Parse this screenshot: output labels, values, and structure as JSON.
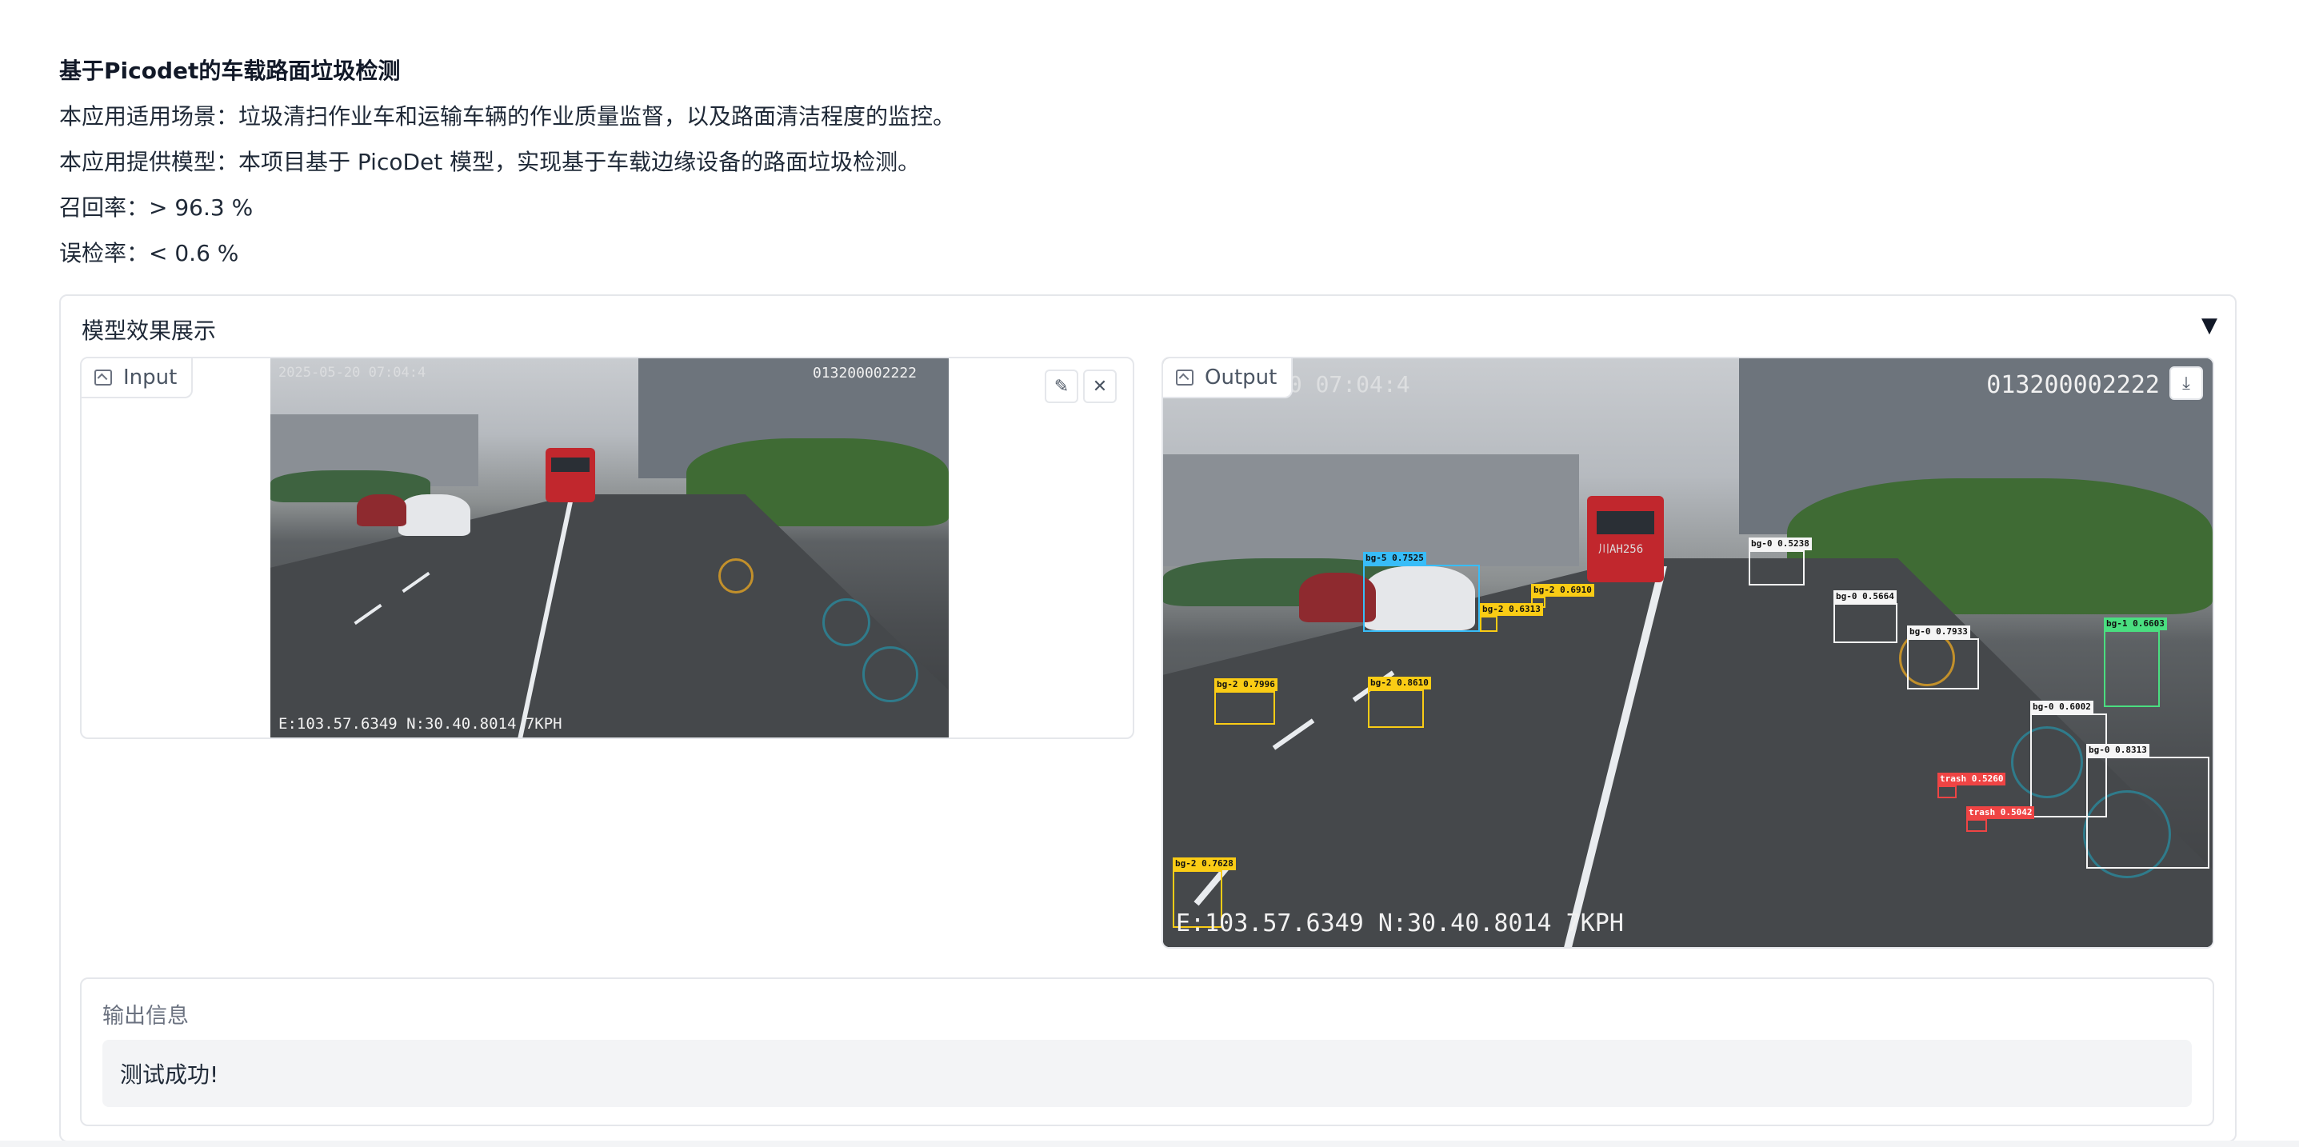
{
  "intro": {
    "title": "基于Picodet的车载路面垃圾检测",
    "scenario": "本应用适用场景：垃圾清扫作业车和运输车辆的作业质量监督，以及路面清洁程度的监控。",
    "model": "本应用提供模型：本项目基于 PicoDet 模型，实现基于车载边缘设备的路面垃圾检测。",
    "recall": "召回率：> 96.3 %",
    "false_detection": "误检率：< 0.6 %"
  },
  "accordion": {
    "title": "模型效果展示",
    "toggle_icon": "▼"
  },
  "input_panel": {
    "label": "Input",
    "edit_icon": "✎",
    "close_icon": "✕",
    "overlay_time": "2025-05-20 07:04:4",
    "overlay_id": "013200002222",
    "overlay_gps": "E:103.57.6349 N:30.40.8014 7KPH"
  },
  "output_panel": {
    "label": "Output",
    "download_icon": "⤓",
    "overlay_time": "20 07:04:4",
    "overlay_id": "013200002222",
    "overlay_gps": "E:103.57.6349 N:30.40.8014 7KPH",
    "plate": "川AH256",
    "detections": [
      {
        "label": "bg-5 0.7525",
        "color": "#38bdf8"
      },
      {
        "label": "bg-2 0.6910",
        "color": "#facc15"
      },
      {
        "label": "bg-2 0.6313",
        "color": "#facc15"
      },
      {
        "label": "bg-2 0.7996",
        "color": "#facc15"
      },
      {
        "label": "bg-2 0.8610",
        "color": "#facc15"
      },
      {
        "label": "bg-0 0.5238",
        "color": "#f5f5f5"
      },
      {
        "label": "bg-0 0.5664",
        "color": "#f5f5f5"
      },
      {
        "label": "bg-0 0.7933",
        "color": "#f5f5f5"
      },
      {
        "label": "bg-1 0.6603",
        "color": "#4ade80"
      },
      {
        "label": "bg-0 0.6002",
        "color": "#f5f5f5"
      },
      {
        "label": "bg-0 0.8313",
        "color": "#f5f5f5"
      },
      {
        "label": "trash 0.5260",
        "color": "#ef4444"
      },
      {
        "label": "trash 0.5042",
        "color": "#ef4444"
      },
      {
        "label": "bg-2 0.7628",
        "color": "#facc15"
      }
    ]
  },
  "output_info": {
    "label": "输出信息",
    "value": "测试成功!"
  }
}
